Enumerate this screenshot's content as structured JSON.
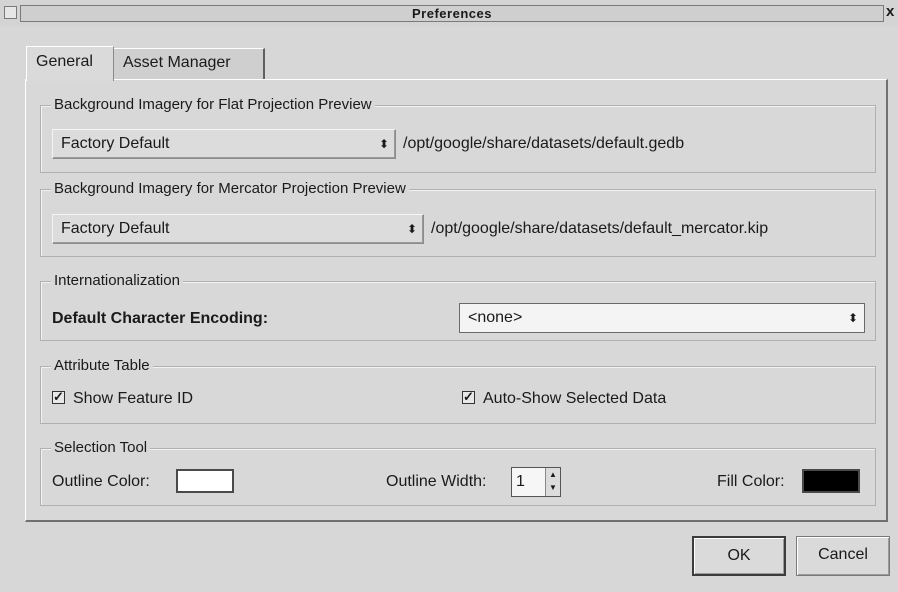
{
  "window": {
    "title": "Preferences",
    "close_glyph": "x"
  },
  "tabs": [
    {
      "label": "General",
      "active": true
    },
    {
      "label": "Asset Manager",
      "active": false
    }
  ],
  "flat_projection": {
    "title": "Background Imagery for Flat Projection Preview",
    "selection": "Factory Default",
    "path": "/opt/google/share/datasets/default.gedb"
  },
  "mercator_projection": {
    "title": "Background Imagery for Mercator Projection Preview",
    "selection": "Factory Default",
    "path": "/opt/google/share/datasets/default_mercator.kip"
  },
  "internationalization": {
    "title": "Internationalization",
    "encoding_label": "Default Character Encoding:",
    "encoding_value": "<none>"
  },
  "attribute_table": {
    "title": "Attribute Table",
    "show_feature_id": {
      "label": "Show Feature ID",
      "checked": true
    },
    "auto_show_selected": {
      "label": "Auto-Show Selected Data",
      "checked": true
    }
  },
  "selection_tool": {
    "title": "Selection Tool",
    "outline_color_label": "Outline Color:",
    "outline_color": "#ffffff",
    "outline_width_label": "Outline Width:",
    "outline_width": "1",
    "fill_color_label": "Fill Color:",
    "fill_color": "#000000"
  },
  "buttons": {
    "ok": "OK",
    "cancel": "Cancel"
  },
  "icons": {
    "combo_arrow": "updown-arrow-icon",
    "checkbox": "checkbox-checked-icon"
  }
}
